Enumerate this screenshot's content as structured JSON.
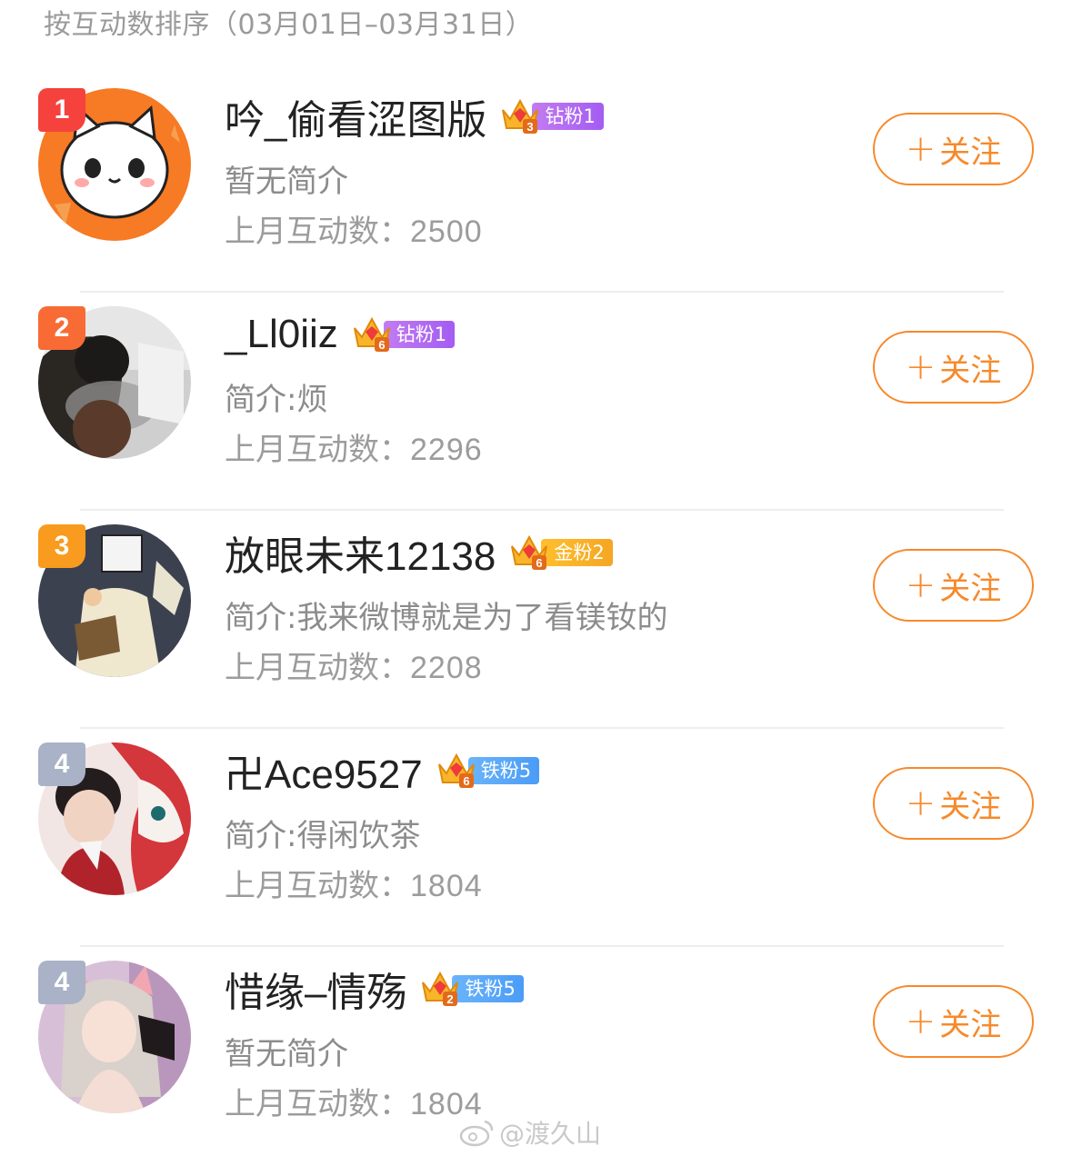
{
  "header": "按互动数排序（03月01日–03月31日）",
  "follow_plus": "+",
  "follow_label": "关注",
  "stat_label": "上月互动数：",
  "users": [
    {
      "rank": "1",
      "name": "吟_偷看涩图版",
      "badge_level": "3",
      "badge_text": "钻粉1",
      "bio": "暂无简介",
      "count": "2500"
    },
    {
      "rank": "2",
      "name": "_Ll0iiz",
      "badge_level": "6",
      "badge_text": "钻粉1",
      "bio": "简介:烦",
      "count": "2296"
    },
    {
      "rank": "3",
      "name": "放眼未来12138",
      "badge_level": "6",
      "badge_text": "金粉2",
      "bio": "简介:我来微博就是为了看镁钕的",
      "count": "2208"
    },
    {
      "rank": "4",
      "name": "卍Ace9527",
      "badge_level": "6",
      "badge_text": "铁粉5",
      "bio": "简介:得闲饮茶",
      "count": "1804"
    },
    {
      "rank": "4",
      "name": "惜缘–情殇",
      "badge_level": "2",
      "badge_text": "铁粉5",
      "bio": "暂无简介",
      "count": "1804"
    }
  ],
  "watermark": "@渡久山",
  "icons": {
    "crown": "crown-icon",
    "weibo": "weibo-logo-icon"
  },
  "colors": {
    "accent": "#f7892a",
    "rank1": "#f5423c",
    "rank2": "#f86b35",
    "rank3": "#f89b1e",
    "rank4": "#a9b2c6",
    "diamond_badge": "#b26cf1",
    "gold_badge": "#f5a623",
    "iron_badge": "#58a8f9"
  }
}
